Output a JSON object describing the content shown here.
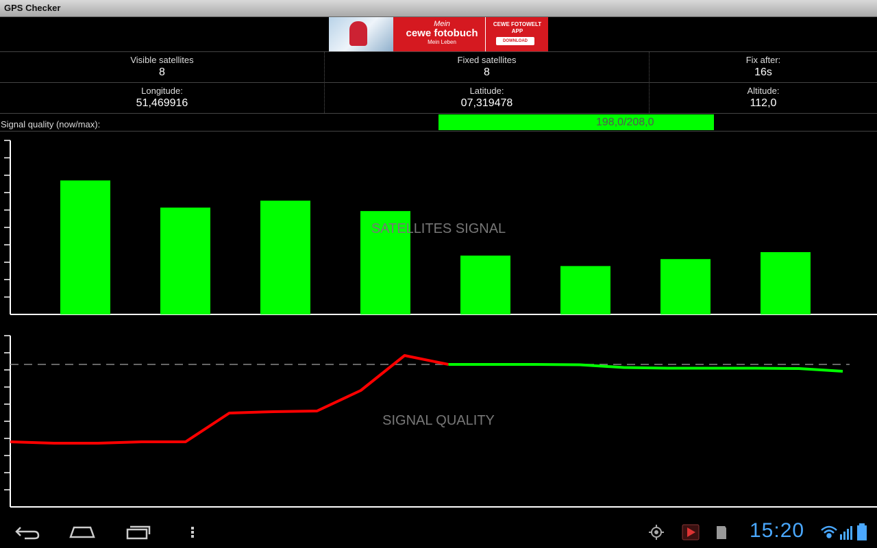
{
  "app": {
    "title": "GPS Checker"
  },
  "ad": {
    "brand_prefix": "Mein",
    "brand_name": "cewe fotobuch",
    "brand_tagline": "Mein Leben",
    "app_label": "CEWE FOTOWELT APP",
    "download_label": "DOWNLOAD"
  },
  "stats": {
    "visible": {
      "label": "Visible satellites",
      "value": "8"
    },
    "fixed": {
      "label": "Fixed satellites",
      "value": "8"
    },
    "fix_after": {
      "label": "Fix after:",
      "value": "16s"
    },
    "longitude": {
      "label": "Longitude:",
      "value": "51,469916"
    },
    "latitude": {
      "label": "Latitude:",
      "value": "07,319478"
    },
    "altitude": {
      "label": "Altitude:",
      "value": "112,0"
    }
  },
  "signal_quality": {
    "label": "Signal quality (now/max):",
    "text": "198,0/208,0",
    "now": 198.0,
    "max": 208.0,
    "bar_color": "#00ff00"
  },
  "chart_data": [
    {
      "type": "bar",
      "title": "SATELLITES SIGNAL",
      "categories": [
        "",
        "",
        "",
        "",
        "",
        "",
        "",
        ""
      ],
      "values": [
        38.5,
        30.7,
        32.7,
        29.7,
        16.9,
        13.9,
        15.9,
        17.9
      ],
      "ylim": [
        0,
        50
      ],
      "y_ticks": 10,
      "color": "#00ff00",
      "grid": false
    },
    {
      "type": "line",
      "title": "SIGNAL QUALITY",
      "x": [
        0,
        1,
        2,
        3,
        4,
        5,
        6,
        7,
        8,
        9,
        10,
        11,
        12,
        13,
        14,
        15,
        16,
        17,
        18,
        19
      ],
      "values": [
        95,
        93,
        93,
        95,
        95,
        137,
        139,
        140,
        170,
        221,
        208,
        208,
        208,
        207.5,
        203.5,
        202.5,
        202.5,
        202.5,
        202,
        198
      ],
      "ylim": [
        0,
        250
      ],
      "y_ticks": 10,
      "reference_line": 208,
      "colors": {
        "before_fix": "#ff0000",
        "after_fix": "#00ff00",
        "reference": "#888888"
      },
      "fix_index": 10,
      "grid": false
    }
  ],
  "system": {
    "clock": "15:20",
    "accent": "#4aa8ff"
  }
}
